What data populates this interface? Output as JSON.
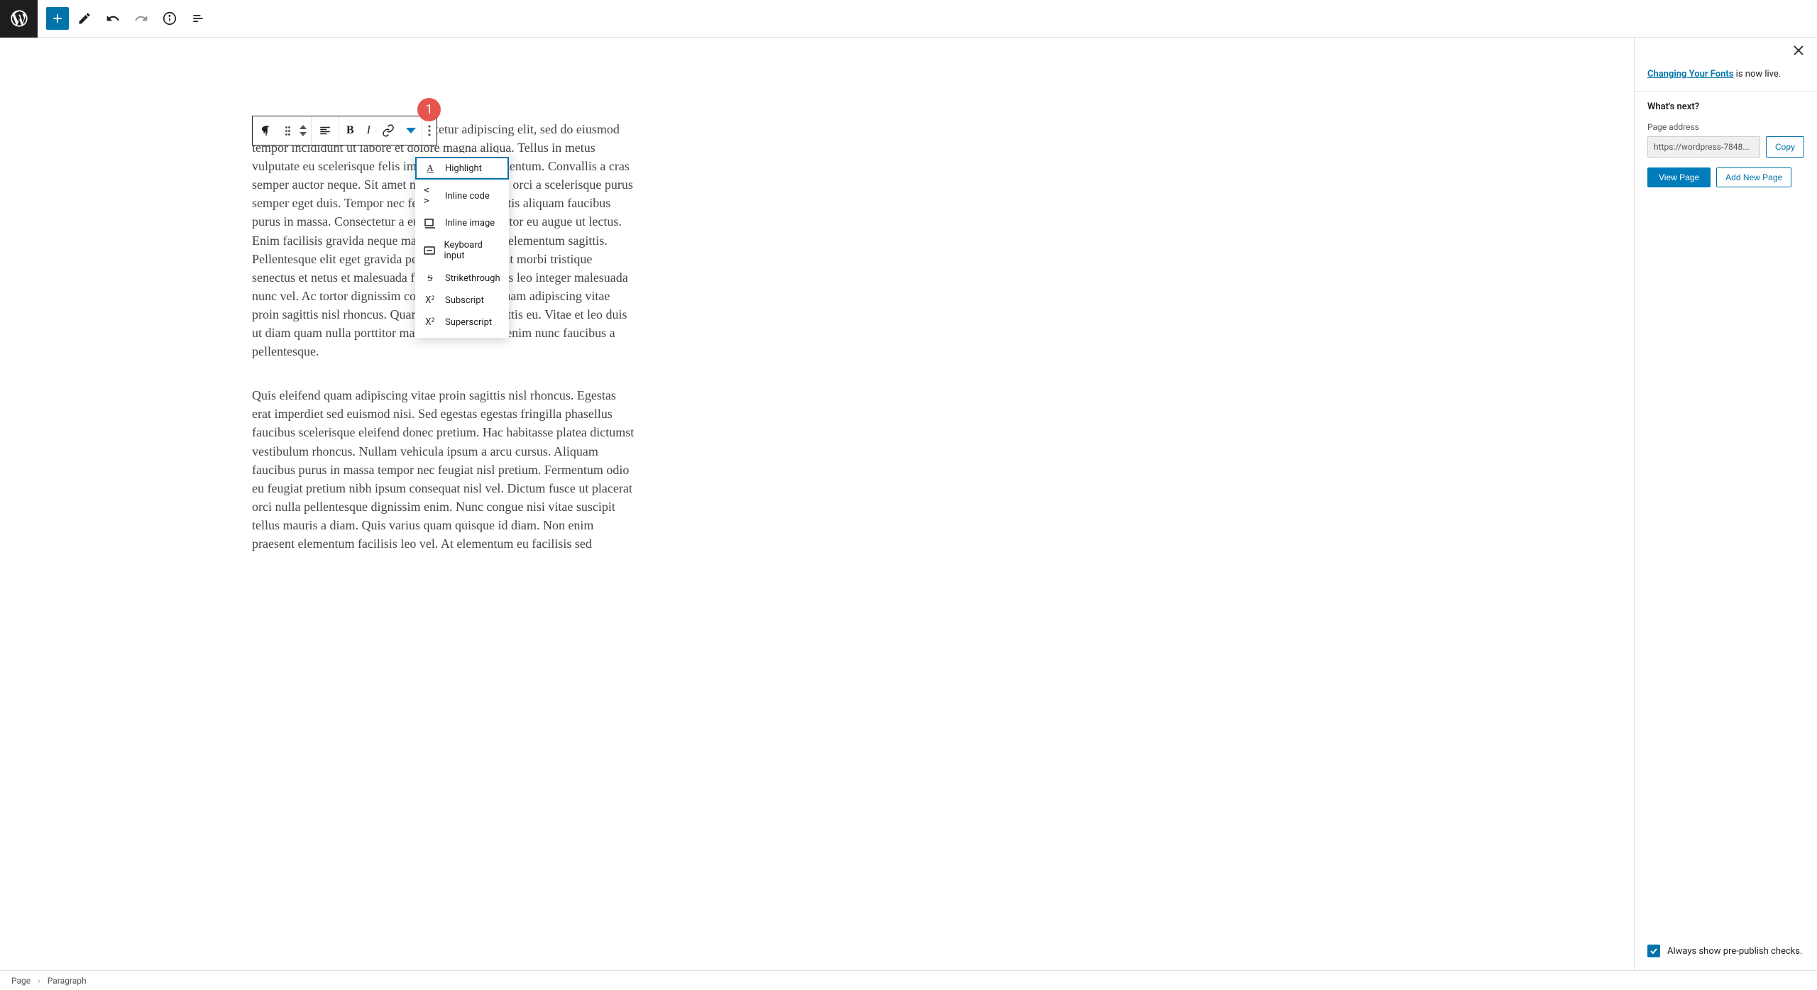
{
  "topbar": {},
  "annotation_number": "1",
  "dropdown_items": [
    {
      "icon": "A",
      "label": "Highlight"
    },
    {
      "icon": "<>",
      "label": "Inline code"
    },
    {
      "icon": "img",
      "label": "Inline image"
    },
    {
      "icon": "kbd",
      "label": "Keyboard input"
    },
    {
      "icon": "S",
      "label": "Strikethrough"
    },
    {
      "icon": "X2",
      "label": "Subscript"
    },
    {
      "icon": "X2s",
      "label": "Superscript"
    }
  ],
  "paragraphs": {
    "p1": "Lorem ipsum dolor sit amet, consectetur adipiscing elit, sed do eiusmod tempor incididunt ut labore et dolore magna aliqua. Tellus in metus vulputate eu scelerisque felis imperdiet proin fermentum. Convallis a cras semper auctor neque. Sit amet nisl suscipit sagittis orci a scelerisque purus semper eget duis. Tempor nec feugiat lobortis mattis aliquam faucibus purus in massa. Consectetur a eu ultrices vitae auctor eu augue ut lectus. Enim facilisis gravida neque mattis enim ut tellus elementum sagittis. Pellentesque elit eget gravida pellentesque habitant morbi tristique senectus et netus et malesuada fames vitae ultricies leo integer malesuada nunc vel. Ac tortor dignissim convallis aenean. Quam adipiscing vitae proin sagittis nisl rhoncus. Quam viverra orci sagittis eu. Vitae et leo duis ut diam quam nulla porttitor massa. Varius morbi enim nunc faucibus a pellentesque.",
    "p2": "Quis eleifend quam adipiscing vitae proin sagittis nisl rhoncus. Egestas erat imperdiet sed euismod nisi. Sed egestas egestas fringilla phasellus faucibus scelerisque eleifend donec pretium. Hac habitasse platea dictumst vestibulum rhoncus. Nullam vehicula ipsum a arcu cursus. Aliquam faucibus purus in massa tempor nec feugiat nisl pretium. Fermentum odio eu feugiat pretium nibh ipsum consequat nisl vel. Dictum fusce ut placerat orci nulla pellentesque dignissim enim. Nunc congue nisi vitae suscipit tellus mauris a diam. Quis varius quam quisque id diam. Non enim praesent elementum facilisis leo vel. At elementum eu facilisis sed"
  },
  "sidebar": {
    "notice_link": "Changing Your Fonts",
    "notice_rest": " is now live.",
    "whats_next": "What's next?",
    "page_address_label": "Page address",
    "url": "https://wordpress-7848...",
    "copy": "Copy",
    "view_page": "View Page",
    "add_new_page": "Add New Page",
    "footer_check_label": "Always show pre-publish checks."
  },
  "breadcrumb": {
    "page": "Page",
    "paragraph": "Paragraph"
  }
}
